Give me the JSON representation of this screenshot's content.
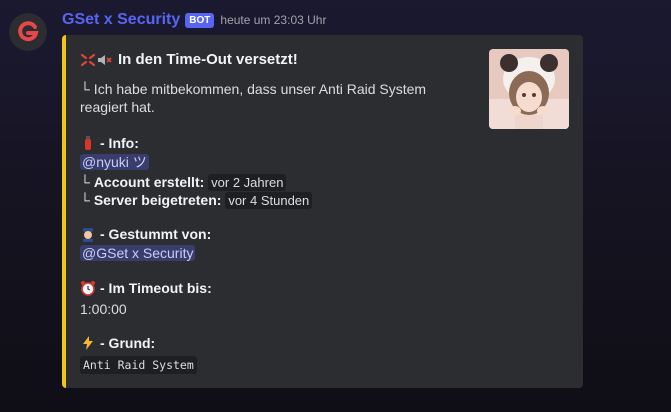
{
  "message": {
    "author": "GSet x Security",
    "bot_badge": "BOT",
    "timestamp": "heute um 23:03 Uhr"
  },
  "embed": {
    "accent_color": "#f0c419",
    "title": "In den Time-Out versetzt!",
    "description": "└ Ich habe mitbekommen, dass unser Anti Raid System reagiert hat.",
    "info": {
      "name": "- Info:",
      "user_mention": "@nyuki ツ",
      "account_created_prefix": "└ ",
      "account_created_label": "Account erstellt:",
      "account_created_value": "vor 2 Jahren",
      "server_joined_prefix": "└ ",
      "server_joined_label": "Server beigetreten:",
      "server_joined_value": "vor 4 Stunden"
    },
    "muted_by": {
      "name": "- Gestummt von:",
      "mention": "@GSet x Security"
    },
    "timeout_until": {
      "name": "- Im Timeout bis:",
      "value": "1:00:00"
    },
    "reason": {
      "name": "- Grund:",
      "value": "Anti Raid System"
    }
  }
}
